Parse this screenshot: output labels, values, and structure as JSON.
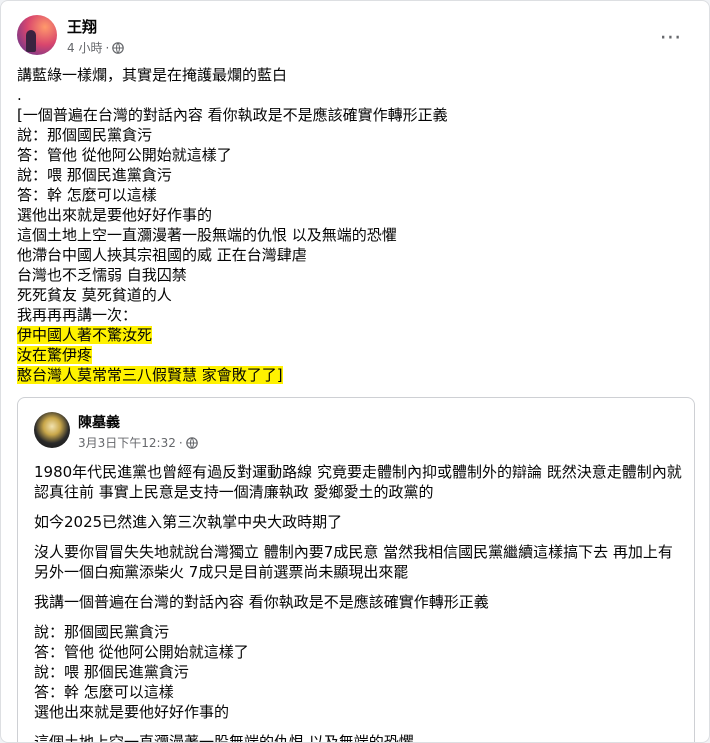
{
  "post": {
    "author": "王翔",
    "time": "4 小時",
    "dot": "·",
    "more_icon": "⋯",
    "body_lines": [
      "講藍綠一樣爛，其實是在掩護最爛的藍白",
      ".",
      "[一個普遍在台灣的對話內容 看你執政是不是應該確實作轉形正義",
      "說：那個國民黨貪污",
      "答：管他 從他阿公開始就這樣了",
      "說：喂 那個民進黨貪污",
      "答：幹 怎麼可以這樣",
      "選他出來就是要他好好作事的",
      "這個土地上空一直瀰漫著一股無端的仇恨 以及無端的恐懼",
      "他滯台中國人挾其宗祖國的威 正在台灣肆虐",
      "台灣也不乏懦弱 自我囚禁",
      "死死貧友 莫死貧道的人",
      "我再再再講一次："
    ],
    "highlight_lines": [
      "伊中國人著不驚汝死",
      "汝在驚伊疼",
      "憨台灣人莫常常三八假賢慧 家會敗了了]"
    ]
  },
  "shared": {
    "author": "陳墓義",
    "time": "3月3日下午12:32",
    "dot": "·",
    "para1": [
      "1980年代民進黨也曾經有過反對運動路線 究竟要走體制內抑或體制外的辯論 既然決意走體制內就",
      "認真往前 事實上民意是支持一個清廉執政 愛鄉愛土的政黨的"
    ],
    "para2": [
      "如今2025已然進入第三次執掌中央大政時期了"
    ],
    "para3": [
      "沒人要你冒冒失失地就說台灣獨立 體制內要7成民意 當然我相信國民黨繼續這樣搞下去 再加上有",
      "另外一個白痴黨添柴火 7成只是目前選票尚未顯現出來罷"
    ],
    "para4": [
      "我講一個普遍在台灣的對話內容 看你執政是不是應該確實作轉形正義"
    ],
    "para5": [
      "說：那個國民黨貪污",
      "答：管他 從他阿公開始就這樣了",
      "說：喂 那個民進黨貪污",
      "答：幹 怎麼可以這樣",
      "選他出來就是要他好好作事的"
    ],
    "para6": [
      "這個土地上空一直瀰漫著一股無端的仇恨 以及無端的恐懼"
    ]
  },
  "colors": {
    "highlight": "#fff200",
    "meta_text": "#65676b",
    "border": "#ced0d4"
  },
  "icons": {
    "globe": "globe-icon",
    "more": "more-horizontal-icon"
  }
}
